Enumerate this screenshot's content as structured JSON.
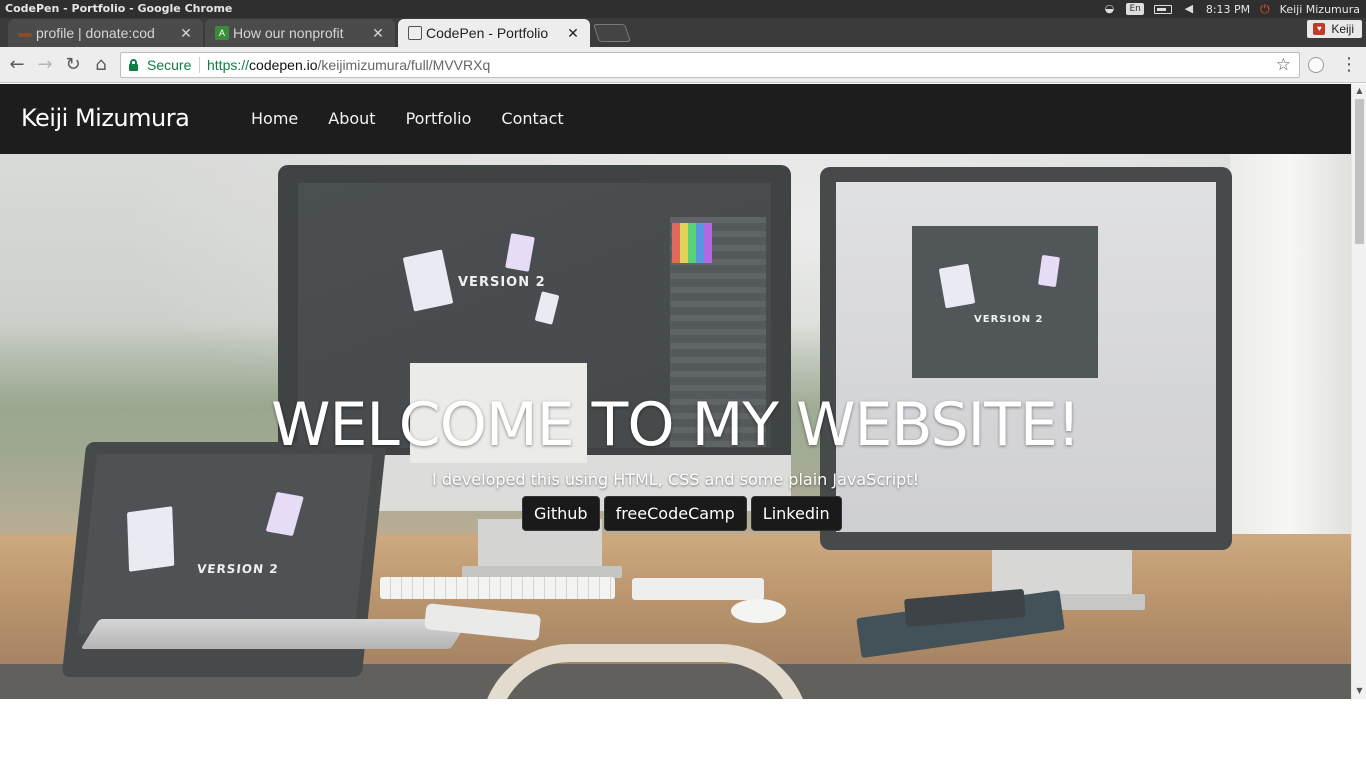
{
  "os": {
    "window_title": "CodePen - Portfolio - Google Chrome",
    "keyboard_layout": "En",
    "clock": "8:13 PM",
    "user": "Keiji Mizumura"
  },
  "browser": {
    "tabs": [
      {
        "title": "profile | donate:cod",
        "favicon": "freecodecamp-icon"
      },
      {
        "title": "How our nonprofit",
        "favicon": "android-icon"
      },
      {
        "title": "CodePen - Portfolio",
        "favicon": "codepen-icon",
        "active": true
      }
    ],
    "profile_chip": "Keiji",
    "omnibox": {
      "security_label": "Secure",
      "url_scheme": "https://",
      "url_host": "codepen.io",
      "url_path": "/keijimizumura/full/MVVRXq"
    },
    "colors": {
      "secure_green": "#0b8043",
      "tab_active": "#ededed",
      "tab_inactive": "#4b4b4b"
    }
  },
  "site": {
    "brand": "Keiji Mizumura",
    "nav": [
      "Home",
      "About",
      "Portfolio",
      "Contact"
    ],
    "hero": {
      "title": "WELCOME TO MY WEBSITE!",
      "subtitle": "I developed this using HTML, CSS and some plain JavaScript!",
      "buttons": [
        "Github",
        "freeCodeCamp",
        "Linkedin"
      ],
      "screen_logo_text": "VERSION 2"
    },
    "colors": {
      "navbar_bg": "#1d1d1d",
      "button_bg": "#1a1a1a"
    }
  }
}
